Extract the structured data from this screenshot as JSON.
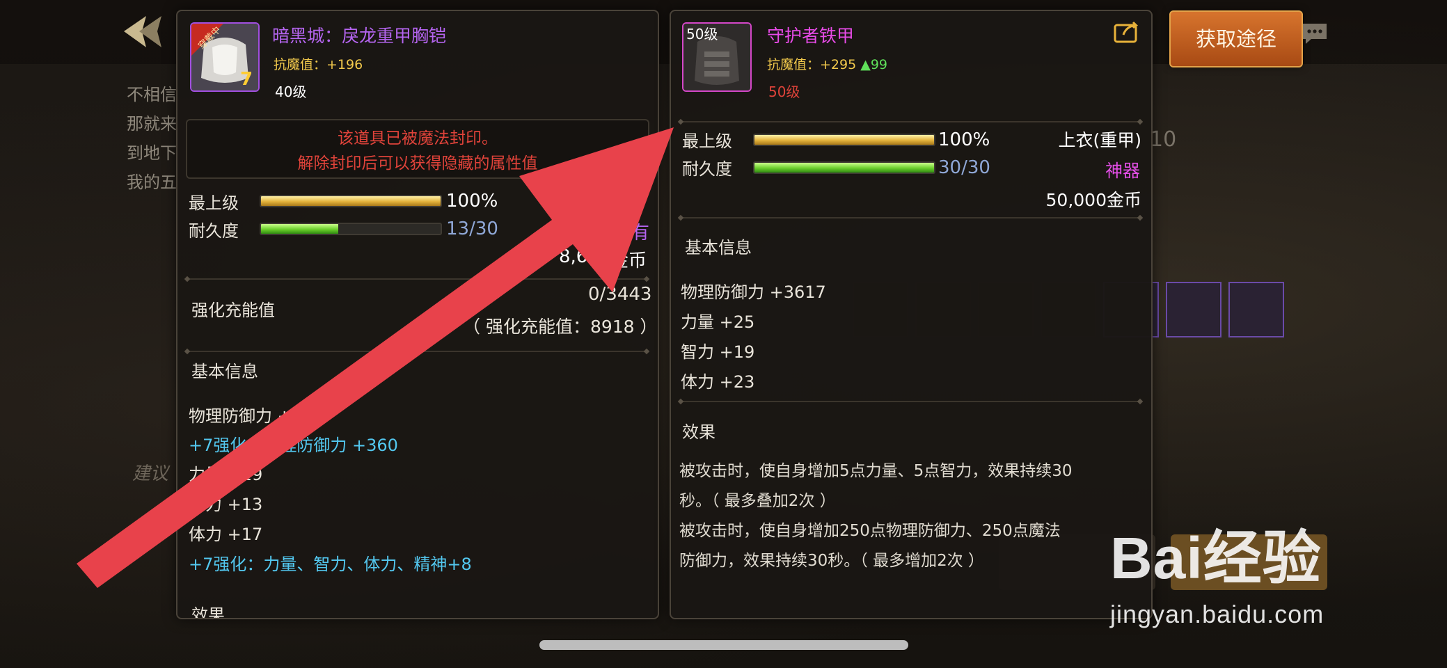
{
  "colors": {
    "epic_purple": "#b565f0",
    "pink_name": "#e84be8",
    "gold_text": "#f2c94c",
    "seal_red": "#e0433a",
    "cyan_bonus": "#53c8f0",
    "gain_green": "#5fe05a",
    "durability_value": "#8fa7d6",
    "arrow_red": "#e8424b",
    "artifact_pink": "#e34ee6"
  },
  "background": {
    "hint_lines": [
      "不相信",
      "那就来",
      "到地下",
      "我的五"
    ],
    "suggest_text": "建议",
    "number_text": "10"
  },
  "left_panel": {
    "equipped_badge": "穿戴中",
    "enhance_badge": "7",
    "name": "暗黑城：戾龙重甲胸铠",
    "resist": "抗魔值：+196",
    "level": "40级",
    "seal_line1": "该道具已被魔法封印。",
    "seal_line2": "解除封印后可以获得隐藏的属性值",
    "max_label": "最上级",
    "max_value": "100%",
    "max_percent": 100,
    "durability_label": "耐久度",
    "durability_value": "13/30",
    "durability_percent": 43,
    "price": "8,6",
    "price_unit": "金币",
    "partial_label": "有",
    "charge_label": "强化充能值",
    "charge_value": "0/3443",
    "charge_note": "（ 强化充能值：8918 ）",
    "basic_title": "基本信息",
    "attrs": [
      {
        "text": "物理防御力 +1",
        "color": "#e9e4da"
      },
      {
        "text": "+7强化：物理防御力 +360",
        "color": "#53c8f0"
      },
      {
        "text": "力量 +19",
        "color": "#e9e4da"
      },
      {
        "text": "智力 +13",
        "color": "#e9e4da"
      },
      {
        "text": "体力 +17",
        "color": "#e9e4da"
      },
      {
        "text": "+7强化：力量、智力、体力、精神+8",
        "color": "#53c8f0"
      }
    ],
    "effect_title": "效果"
  },
  "right_panel": {
    "level_badge": "50级",
    "name": "守护者铁甲",
    "resist": "抗魔值：+295",
    "resist_gain": "▲99",
    "level": "50级",
    "max_label": "最上级",
    "max_value": "100%",
    "max_percent": 100,
    "durability_label": "耐久度",
    "durability_value": "30/30",
    "durability_percent": 100,
    "slot_type": "上衣(重甲)",
    "rarity": "神器",
    "price": "50,000金币",
    "basic_title": "基本信息",
    "attrs": [
      "物理防御力 +3617",
      "力量 +25",
      "智力 +19",
      "体力 +23"
    ],
    "effect_title": "效果",
    "effect_lines": [
      "被攻击时，使自身增加5点力量、5点智力，效果持续30",
      "秒。（ 最多叠加2次 ）",
      "被攻击时，使自身增加250点物理防御力、250点魔法",
      "防御力，效果持续30秒。（ 最多增加2次 ）"
    ]
  },
  "get_button": "获取途径",
  "watermark": {
    "logo": "Bai经验",
    "url": "jingyan.baidu.com"
  }
}
